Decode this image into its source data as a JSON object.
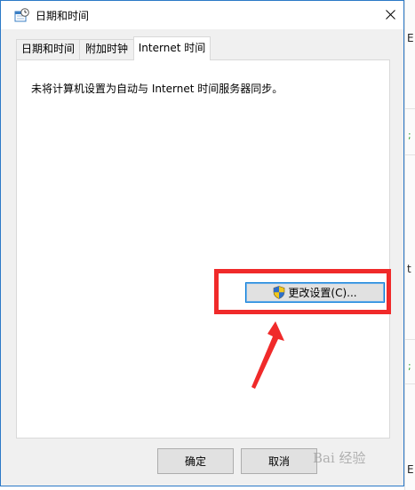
{
  "window": {
    "title": "日期和时间",
    "close_glyph": "✕"
  },
  "tabs": [
    {
      "label": "日期和时间"
    },
    {
      "label": "附加时钟"
    },
    {
      "label": "Internet 时间"
    }
  ],
  "panel": {
    "message": "未将计算机设置为自动与 Internet 时间服务器同步。",
    "change_settings_label": "更改设置(C)..."
  },
  "footer": {
    "ok_label": "确定",
    "cancel_label": "取消"
  },
  "background_window": {
    "chars": [
      "E",
      "t",
      "E"
    ]
  },
  "watermark": "Bai 经验",
  "colors": {
    "annotation": "#f02a2a",
    "focus_border": "#0078d7",
    "window_border": "#2b79c7"
  }
}
